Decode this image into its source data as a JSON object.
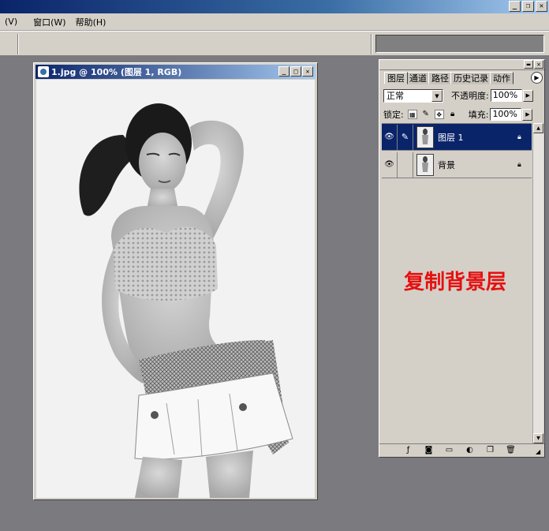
{
  "menu": {
    "items": [
      {
        "label": "(V)"
      },
      {
        "label": "窗口(W)"
      },
      {
        "label": "帮助(H)"
      }
    ]
  },
  "app_controls": {
    "minimize": "_",
    "restore": "❐",
    "close": "✕"
  },
  "document": {
    "title": "1.jpg @ 100% (图层 1, RGB)",
    "controls": {
      "minimize": "_",
      "maximize": "□",
      "close": "✕"
    }
  },
  "layers_panel": {
    "tabs": [
      {
        "label": "图层",
        "active": true
      },
      {
        "label": "通道",
        "active": false
      },
      {
        "label": "路径",
        "active": false
      },
      {
        "label": "历史记录",
        "active": false
      },
      {
        "label": "动作",
        "active": false
      }
    ],
    "blend_mode": "正常",
    "opacity_label": "不透明度:",
    "opacity_value": "100%",
    "lock_label": "锁定:",
    "fill_label": "填充:",
    "fill_value": "100%",
    "layers": [
      {
        "name": "图层 1",
        "selected": true
      },
      {
        "name": "背景",
        "selected": false
      }
    ],
    "annotation": "复制背景层"
  }
}
